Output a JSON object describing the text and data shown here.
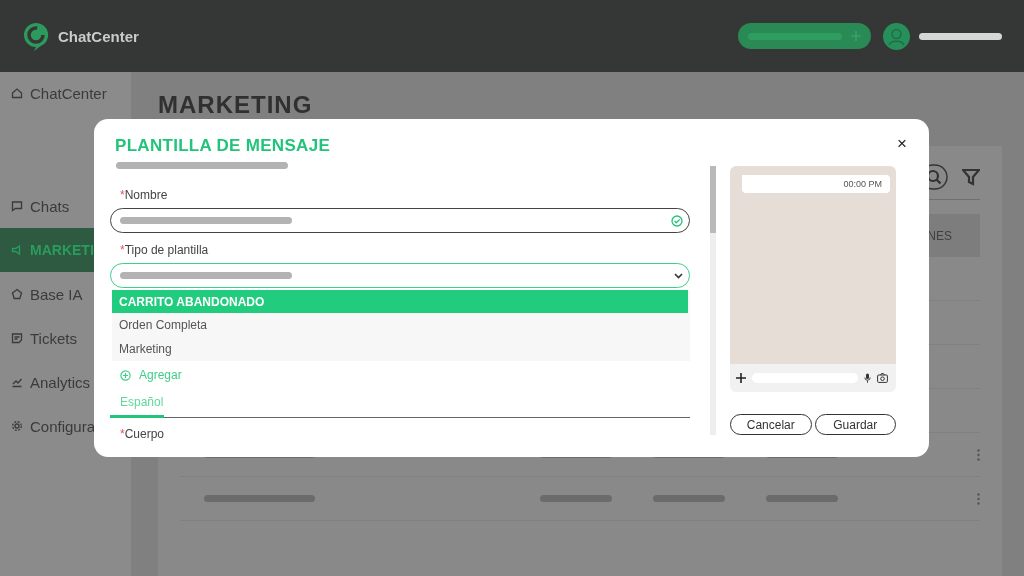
{
  "header": {
    "logo_text": "ChatCenter"
  },
  "sidebar": {
    "items": [
      {
        "label": "ChatCenter",
        "selected": false
      },
      {
        "label": "Chats",
        "selected": false
      },
      {
        "label": "MARKETI",
        "selected": true
      },
      {
        "label": "Base IA",
        "selected": false
      },
      {
        "label": "Tickets",
        "selected": false
      },
      {
        "label": "Analytics",
        "selected": false
      },
      {
        "label": "Configura",
        "selected": false
      }
    ]
  },
  "page": {
    "title": "MARKETING",
    "table": {
      "columns": [
        "NES"
      ]
    }
  },
  "modal": {
    "title": "PLANTILLA DE MENSAJE",
    "close": "×",
    "fields": [
      {
        "kind": "text",
        "mark": "*",
        "label": "Nombre",
        "valid": true
      },
      {
        "kind": "select",
        "mark": "*",
        "label": "Tipo de plantilla",
        "expanded": true,
        "options": [
          {
            "label": "CARRITO ABANDONADO",
            "selected": true
          },
          {
            "label": "Orden Completa",
            "selected": false
          },
          {
            "label": "Marketing",
            "selected": false
          }
        ]
      }
    ],
    "add_label": "Agregar",
    "tabs": [
      {
        "label": "Español",
        "selected": true
      }
    ],
    "body_field": {
      "mark": "*",
      "label": "Cuerpo"
    },
    "preview": {
      "time": "00:00 PM"
    },
    "buttons": [
      "Cancelar",
      "Guardar"
    ]
  }
}
